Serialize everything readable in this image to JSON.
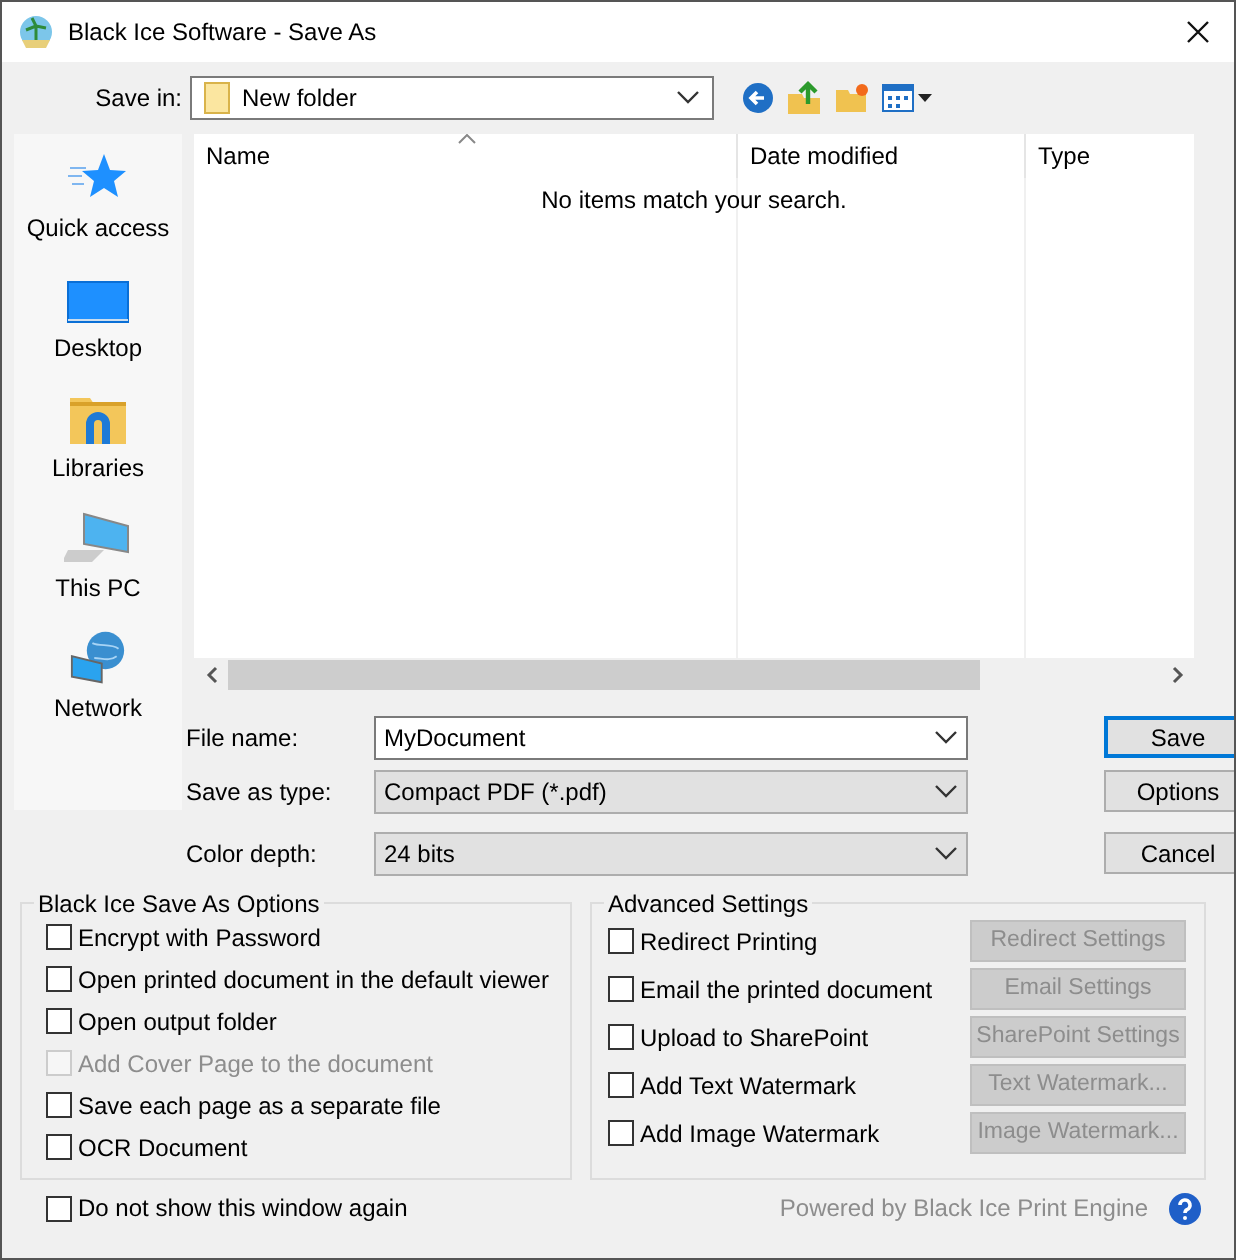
{
  "window": {
    "title": "Black Ice Software - Save As"
  },
  "save_in": {
    "label": "Save in:",
    "value": "New folder"
  },
  "sidebar": {
    "items": [
      {
        "label": "Quick access",
        "kind": "star"
      },
      {
        "label": "Desktop",
        "kind": "desktop"
      },
      {
        "label": "Libraries",
        "kind": "libraries"
      },
      {
        "label": "This PC",
        "kind": "pc"
      },
      {
        "label": "Network",
        "kind": "network"
      }
    ]
  },
  "file_list": {
    "columns": [
      "Name",
      "Date modified",
      "Type"
    ],
    "empty_message": "No items match your search."
  },
  "fields": [
    {
      "label": "File name:",
      "value": "MyDocument",
      "kind": "input"
    },
    {
      "label": "Save as type:",
      "value": "Compact PDF (*.pdf)",
      "kind": "select"
    },
    {
      "label": "Color depth:",
      "value": "24 bits",
      "kind": "select"
    }
  ],
  "buttons": [
    {
      "label": "Save",
      "default": true
    },
    {
      "label": "Options",
      "default": false
    },
    {
      "label": "Cancel",
      "default": false
    }
  ],
  "options_group": {
    "title": "Black Ice Save As Options",
    "items": [
      {
        "label": "Encrypt with Password",
        "checked": false,
        "disabled": false
      },
      {
        "label": "Open printed document in the default viewer",
        "checked": false,
        "disabled": false
      },
      {
        "label": "Open output folder",
        "checked": false,
        "disabled": false
      },
      {
        "label": "Add Cover Page to the document",
        "checked": false,
        "disabled": true
      },
      {
        "label": "Save each page as a separate file",
        "checked": false,
        "disabled": false
      },
      {
        "label": "OCR Document",
        "checked": false,
        "disabled": false
      }
    ]
  },
  "advanced_group": {
    "title": "Advanced Settings",
    "items": [
      {
        "label": "Redirect Printing",
        "checked": false,
        "button": {
          "label": "Redirect Settings",
          "disabled": true
        }
      },
      {
        "label": "Email the printed document",
        "checked": false,
        "button": {
          "label": "Email Settings",
          "disabled": true
        }
      },
      {
        "label": "Upload to SharePoint",
        "checked": false,
        "button": {
          "label": "SharePoint Settings",
          "disabled": true
        }
      },
      {
        "label": "Add Text Watermark",
        "checked": false,
        "button": {
          "label": "Text Watermark...",
          "disabled": true
        }
      },
      {
        "label": "Add Image Watermark",
        "checked": false,
        "button": {
          "label": "Image Watermark...",
          "disabled": true
        }
      }
    ]
  },
  "footer": {
    "checkbox": {
      "label": "Do not show this window again",
      "checked": false
    },
    "powered_by": "Powered by Black Ice Print Engine"
  }
}
